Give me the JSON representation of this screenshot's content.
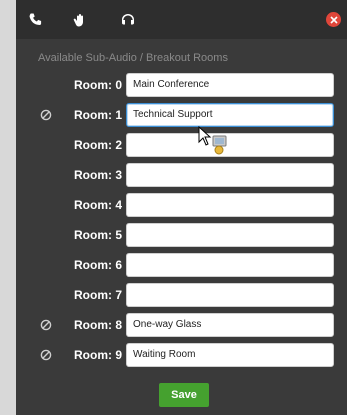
{
  "toolbar": {
    "tabs": [
      {
        "icon": "phone-icon"
      },
      {
        "icon": "hand-icon"
      },
      {
        "icon": "headset-icon"
      }
    ],
    "close_icon": "close-icon",
    "close_color": "#e0463a"
  },
  "subtitle": "Available Sub-Audio / Breakout Rooms",
  "rooms": [
    {
      "label": "Room: 0",
      "value": "Main Conference",
      "status_icon": ""
    },
    {
      "label": "Room: 1",
      "value": "Technical Support",
      "status_icon": "prohibited-icon"
    },
    {
      "label": "Room: 2",
      "value": "",
      "status_icon": ""
    },
    {
      "label": "Room: 3",
      "value": "",
      "status_icon": ""
    },
    {
      "label": "Room: 4",
      "value": "",
      "status_icon": ""
    },
    {
      "label": "Room: 5",
      "value": "",
      "status_icon": ""
    },
    {
      "label": "Room: 6",
      "value": "",
      "status_icon": ""
    },
    {
      "label": "Room: 7",
      "value": "",
      "status_icon": ""
    },
    {
      "label": "Room: 8",
      "value": "One-way Glass",
      "status_icon": "prohibited-icon"
    },
    {
      "label": "Room: 9",
      "value": "Waiting Room",
      "status_icon": "prohibited-icon"
    }
  ],
  "save_label": "Save",
  "colors": {
    "accent": "#45a12f",
    "panel": "#3a3a3a",
    "focus": "#3b8fd6"
  }
}
